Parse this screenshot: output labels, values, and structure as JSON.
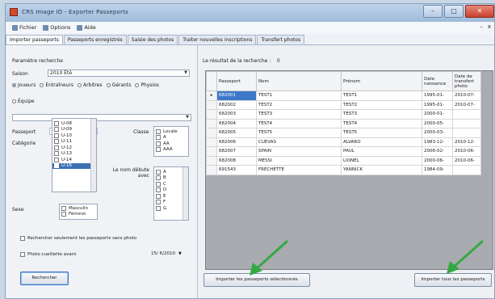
{
  "window": {
    "title": "CRS Image ID - Exporter Passeports",
    "controls": {
      "minimize": "–",
      "maximize": "□",
      "close": "✕"
    }
  },
  "menu": {
    "items": [
      "Fichier",
      "Options",
      "Aide"
    ],
    "right": {
      "minimize": "–",
      "close": "x"
    }
  },
  "tabs": [
    "Importer passeports",
    "Passeports enregistrés",
    "Saisie des photos",
    "Traiter nouvelles inscriptions",
    "Transfert photos"
  ],
  "active_tab": 0,
  "left": {
    "section_title": "Paramètre recherche",
    "saison_label": "Saison",
    "saison_value": "2010 Été",
    "role_options": [
      "Joueurs",
      "Entraîneurs",
      "Arbitres",
      "Gérants",
      "Physios"
    ],
    "role_selected": 0,
    "equipe_label": "Équipe",
    "passeport_label": "Passeport",
    "categorie_label": "Catégorie",
    "categories": [
      "U-08",
      "U-09",
      "U-10",
      "U-11",
      "U-12",
      "U-13",
      "U-14",
      "U-16"
    ],
    "categorie_selected": 7,
    "classe_label": "Classe",
    "classes": [
      "Locale",
      "A",
      "AA",
      "AAA"
    ],
    "nom_label": "Le nom débute avec",
    "letters": [
      "A",
      "B",
      "C",
      "D",
      "E",
      "F",
      "G"
    ],
    "sexe_label": "Sexe",
    "sexes": [
      "Masculin",
      "Féminin"
    ],
    "check_sans_photo": "Rechercher seulement les passeports sans photo",
    "check_photo_avant": "Photo cueillette avant",
    "date_value": "15/ 6/2010",
    "search_button": "Rechercher"
  },
  "right": {
    "result_label": "Le résultat de la recherche :",
    "result_count": "0",
    "columns": [
      "Passeport",
      "Nom",
      "Prénom",
      "Date naissance",
      "Date de transfert photo"
    ],
    "rows": [
      [
        "682001",
        "TEST1",
        "TEST1",
        "1995-01-",
        "2010-07-"
      ],
      [
        "682002",
        "TEST2",
        "TEST2",
        "1995-01-",
        "2010-07-"
      ],
      [
        "682003",
        "TEST3",
        "TEST3",
        "2000-01-",
        ""
      ],
      [
        "682004",
        "TEST4",
        "TEST4",
        "2000-05-",
        ""
      ],
      [
        "682005",
        "TEST5",
        "TEST5",
        "2000-03-",
        ""
      ],
      [
        "682006",
        "CUEVAS",
        "ALVARO",
        "1983-12-",
        "2010-12-"
      ],
      [
        "682007",
        "SPAIN",
        "PAUL",
        "2006-02-",
        "2010-06-"
      ],
      [
        "682008",
        "MESSI",
        "LIONEL",
        "2000-06-",
        "2010-06-"
      ],
      [
        "691543",
        "FRECHETTE",
        "YANNICK",
        "1984-09-",
        ""
      ]
    ],
    "current_row": 0,
    "row_pointer": "▸",
    "btn_import_selected": "Importer les passeports sélectionnés",
    "btn_import_all": "Importer tous les passeports"
  },
  "colors": {
    "accent": "#3d6fb5",
    "annotation": "#35a845"
  }
}
